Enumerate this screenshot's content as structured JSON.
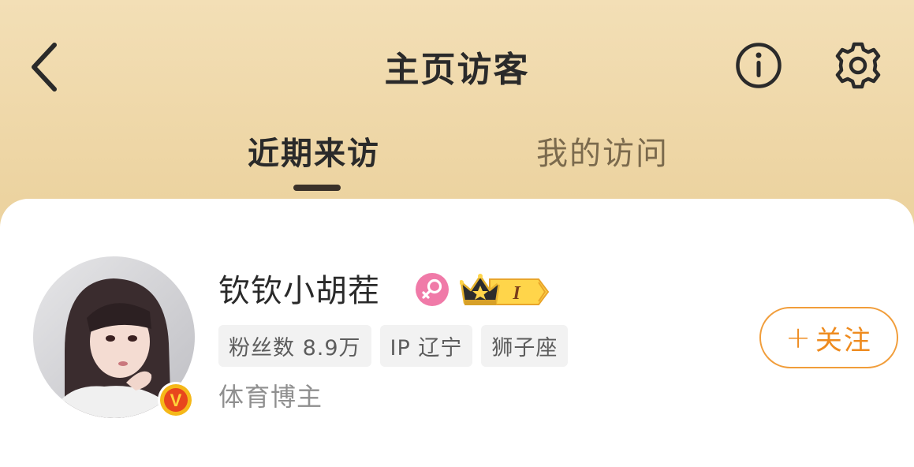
{
  "header": {
    "title": "主页访客",
    "back_icon": "chevron-left-icon",
    "info_icon": "info-icon",
    "settings_icon": "gear-icon"
  },
  "tabs": [
    {
      "label": "近期来访",
      "active": true
    },
    {
      "label": "我的访问",
      "active": false
    }
  ],
  "visitor": {
    "name": "钦钦小胡茬",
    "gender_badge": "female-icon",
    "level_badge": "crown-badge",
    "level_text": "I",
    "verified_badge": "V",
    "tags": [
      "粉丝数 8.9万",
      "IP 辽宁",
      "狮子座"
    ],
    "description": "体育博主",
    "follow_plus": "+",
    "follow_label": "关注"
  },
  "colors": {
    "accent": "#ee8b1f",
    "header_bg": "#ecd3a0",
    "female_badge": "#f07aa8"
  }
}
